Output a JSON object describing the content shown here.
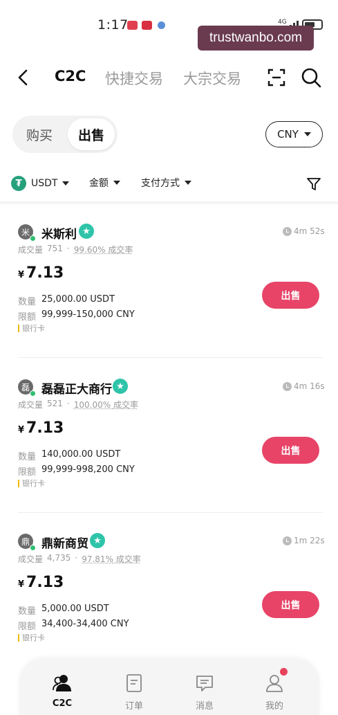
{
  "status_bar": {
    "time": "1:17",
    "network": "4G"
  },
  "watermark": "trustwanbo.com",
  "header": {
    "tabs": [
      {
        "label": "C2C",
        "active": true
      },
      {
        "label": "快捷交易",
        "active": false
      },
      {
        "label": "大宗交易",
        "active": false
      }
    ]
  },
  "toggle": {
    "buy_label": "购买",
    "sell_label": "出售",
    "selected": "出售"
  },
  "currency": "CNY",
  "filters": {
    "asset": "USDT",
    "amount": "金额",
    "payment": "支付方式"
  },
  "labels": {
    "volume": "成交量",
    "rate": "成交率",
    "quantity": "数量",
    "limit": "限额",
    "yen": "¥",
    "action": "出售"
  },
  "merchants": [
    {
      "avatar_char": "米",
      "name": "米斯利",
      "elapsed": "4m 52s",
      "volume": "751",
      "completion": "99.60%",
      "price": "7.13",
      "quantity": "25,000.00 USDT",
      "limit": "99,999-150,000 CNY",
      "payment": "银行卡"
    },
    {
      "avatar_char": "磊",
      "name": "磊磊正大商行",
      "elapsed": "4m 16s",
      "volume": "521",
      "completion": "100.00%",
      "price": "7.13",
      "quantity": "140,000.00 USDT",
      "limit": "99,999-998,200 CNY",
      "payment": "银行卡"
    },
    {
      "avatar_char": "鼎",
      "name": "鼎新商贸",
      "elapsed": "1m 22s",
      "volume": "4,735",
      "completion": "97.81%",
      "price": "7.13",
      "quantity": "5,000.00 USDT",
      "limit": "34,400-34,400 CNY",
      "payment": "银行卡"
    }
  ],
  "nav": [
    {
      "label": "C2C",
      "icon": "user-group-icon",
      "active": true
    },
    {
      "label": "订单",
      "icon": "order-icon",
      "active": false
    },
    {
      "label": "消息",
      "icon": "message-icon",
      "active": false
    },
    {
      "label": "我的",
      "icon": "profile-icon",
      "active": false
    }
  ],
  "colors": {
    "sell_button": "#e74468",
    "verified_badge": "#2ec4a9",
    "tether": "#26a17b",
    "notification": "#e8435c"
  }
}
